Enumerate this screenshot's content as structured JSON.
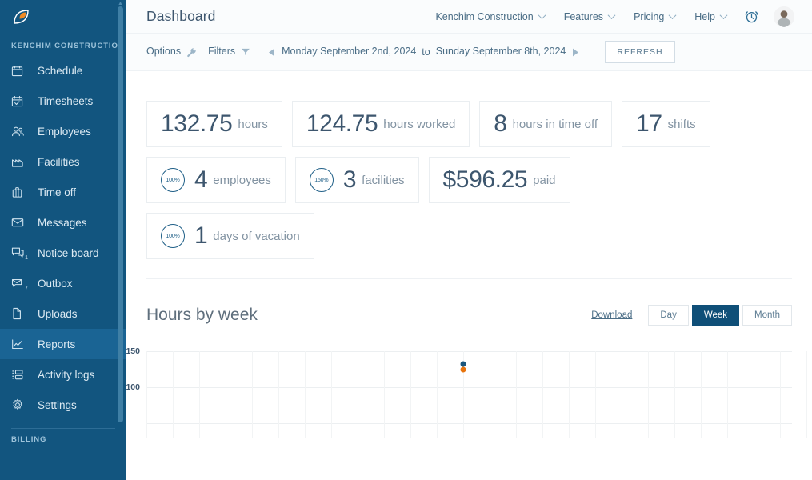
{
  "sidebar": {
    "logo_icon": "leaf-logo",
    "org_label": "KENCHIM CONSTRUCTION",
    "items": [
      {
        "label": "Schedule",
        "icon": "calendar-icon",
        "badge": ""
      },
      {
        "label": "Timesheets",
        "icon": "calendar-check-icon",
        "badge": ""
      },
      {
        "label": "Employees",
        "icon": "people-icon",
        "badge": ""
      },
      {
        "label": "Facilities",
        "icon": "factory-icon",
        "badge": ""
      },
      {
        "label": "Time off",
        "icon": "briefcase-icon",
        "badge": ""
      },
      {
        "label": "Messages",
        "icon": "envelope-icon",
        "badge": ""
      },
      {
        "label": "Notice board",
        "icon": "chat-icon",
        "badge": "1"
      },
      {
        "label": "Outbox",
        "icon": "outbox-icon",
        "badge": "7"
      },
      {
        "label": "Uploads",
        "icon": "file-icon",
        "badge": ""
      },
      {
        "label": "Reports",
        "icon": "chart-line-icon",
        "badge": "",
        "active": true
      },
      {
        "label": "Activity logs",
        "icon": "list-icon",
        "badge": ""
      },
      {
        "label": "Settings",
        "icon": "gear-icon",
        "badge": ""
      }
    ],
    "billing_label": "BILLING"
  },
  "header": {
    "title": "Dashboard",
    "nav": [
      {
        "label": "Kenchim Construction",
        "caret": true
      },
      {
        "label": "Features",
        "caret": true
      },
      {
        "label": "Pricing",
        "caret": true
      },
      {
        "label": "Help",
        "caret": true
      }
    ],
    "alarm_icon": "alarm-clock-icon",
    "avatar_icon": "user-avatar"
  },
  "filterbar": {
    "options_label": "Options",
    "options_icon": "wrench-icon",
    "filters_label": "Filters",
    "filters_icon": "funnel-icon",
    "prev_icon": "triangle-left-icon",
    "next_icon": "triangle-right-icon",
    "date_from": "Monday September 2nd, 2024",
    "date_to_word": "to",
    "date_to": "Sunday September 8th, 2024",
    "refresh_label": "REFRESH"
  },
  "stats": {
    "row1": [
      {
        "value": "132.75",
        "unit": "hours"
      },
      {
        "value": "124.75",
        "unit": "hours worked"
      },
      {
        "value": "8",
        "unit": "hours in time off"
      },
      {
        "value": "17",
        "unit": "shifts"
      }
    ],
    "row2": [
      {
        "ring": "100%",
        "value": "4",
        "unit": "employees"
      },
      {
        "ring": "150%",
        "value": "3",
        "unit": "facilities"
      },
      {
        "ring": "",
        "value": "$596.25",
        "unit": "paid"
      }
    ],
    "row3": [
      {
        "ring": "100%",
        "value": "1",
        "unit": "days of vacation"
      }
    ]
  },
  "chart_section": {
    "title": "Hours by week",
    "download_label": "Download",
    "ranges": [
      {
        "label": "Day",
        "selected": false
      },
      {
        "label": "Week",
        "selected": true
      },
      {
        "label": "Month",
        "selected": false
      }
    ]
  },
  "chart_data": {
    "type": "scatter",
    "title": "Hours by week",
    "xlabel": "",
    "ylabel": "",
    "ylim": [
      0,
      150
    ],
    "yticks": [
      150,
      100
    ],
    "grid": true,
    "legend": "none",
    "x": [
      "2024-09-02"
    ],
    "series": [
      {
        "name": "hours",
        "color": "#19567d",
        "values": [
          132.75
        ]
      },
      {
        "name": "hours worked",
        "color": "#e8730c",
        "values": [
          124.75
        ]
      }
    ]
  },
  "colors": {
    "sidebar_bg": "#12557f",
    "sidebar_active": "#1a6494",
    "accent": "#0f4f78",
    "series_blue": "#19567d",
    "series_orange": "#e8730c",
    "text_dark": "#3d566e"
  }
}
